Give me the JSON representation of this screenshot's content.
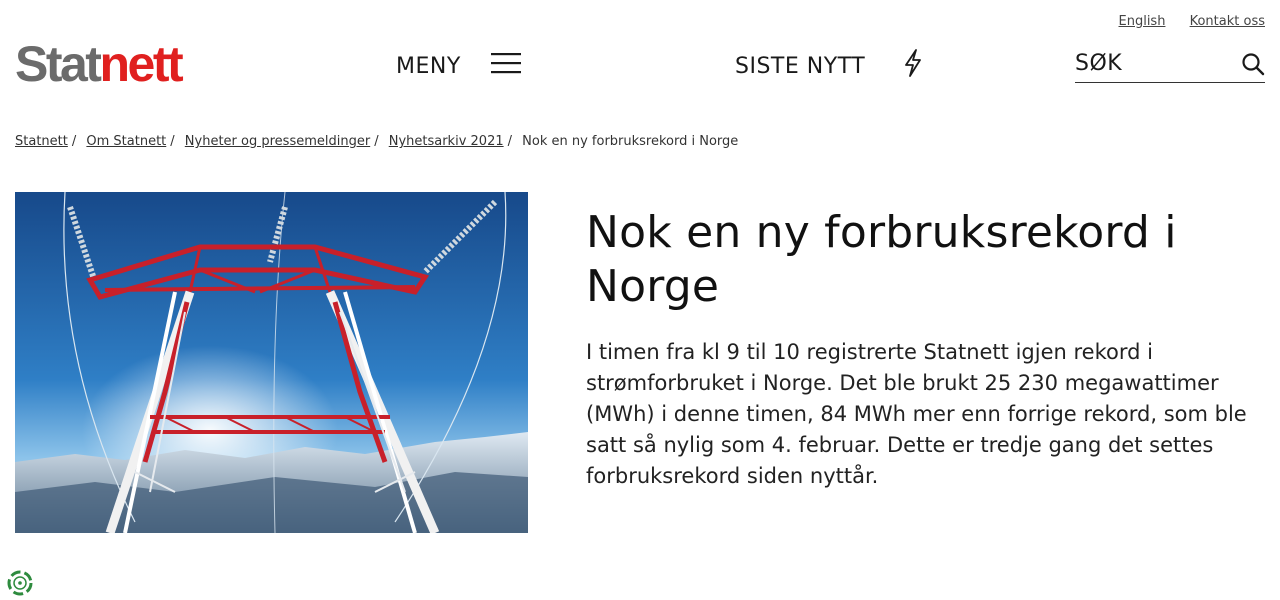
{
  "header": {
    "logo": {
      "part1": "Stat",
      "part2": "nett"
    },
    "utility_links": [
      "English",
      "Kontakt oss"
    ],
    "menu_label": "MENY",
    "menu_icon": "hamburger-icon",
    "news_label": "SISTE NYTT",
    "news_icon": "lightning-icon",
    "search": {
      "placeholder": "SØK",
      "value": "",
      "icon": "search-icon"
    }
  },
  "breadcrumb": {
    "items": [
      "Statnett",
      "Om Statnett",
      "Nyheter og pressemeldinger",
      "Nyhetsarkiv 2021"
    ],
    "current": "Nok en ny forbruksrekord i Norge"
  },
  "article": {
    "title": "Nok en ny forbruksrekord i Norge",
    "lead": "I timen fra kl 9 til 10 registrerte Statnett igjen rekord i strømforbruket i Norge. Det ble brukt 25 230 megawattimer (MWh) i denne timen, 84 MWh mer enn forrige rekord, som ble satt så nylig som 4. februar. Dette er tredje gang det settes forbruksrekord siden nyttår."
  },
  "colors": {
    "brand_red": "#e0201f",
    "brand_gray": "#6b6b6b",
    "sky": "#1f5fa6",
    "pylon_red": "#c8202a"
  },
  "widgets": {
    "cookie_icon": "cookie-consent-icon"
  }
}
